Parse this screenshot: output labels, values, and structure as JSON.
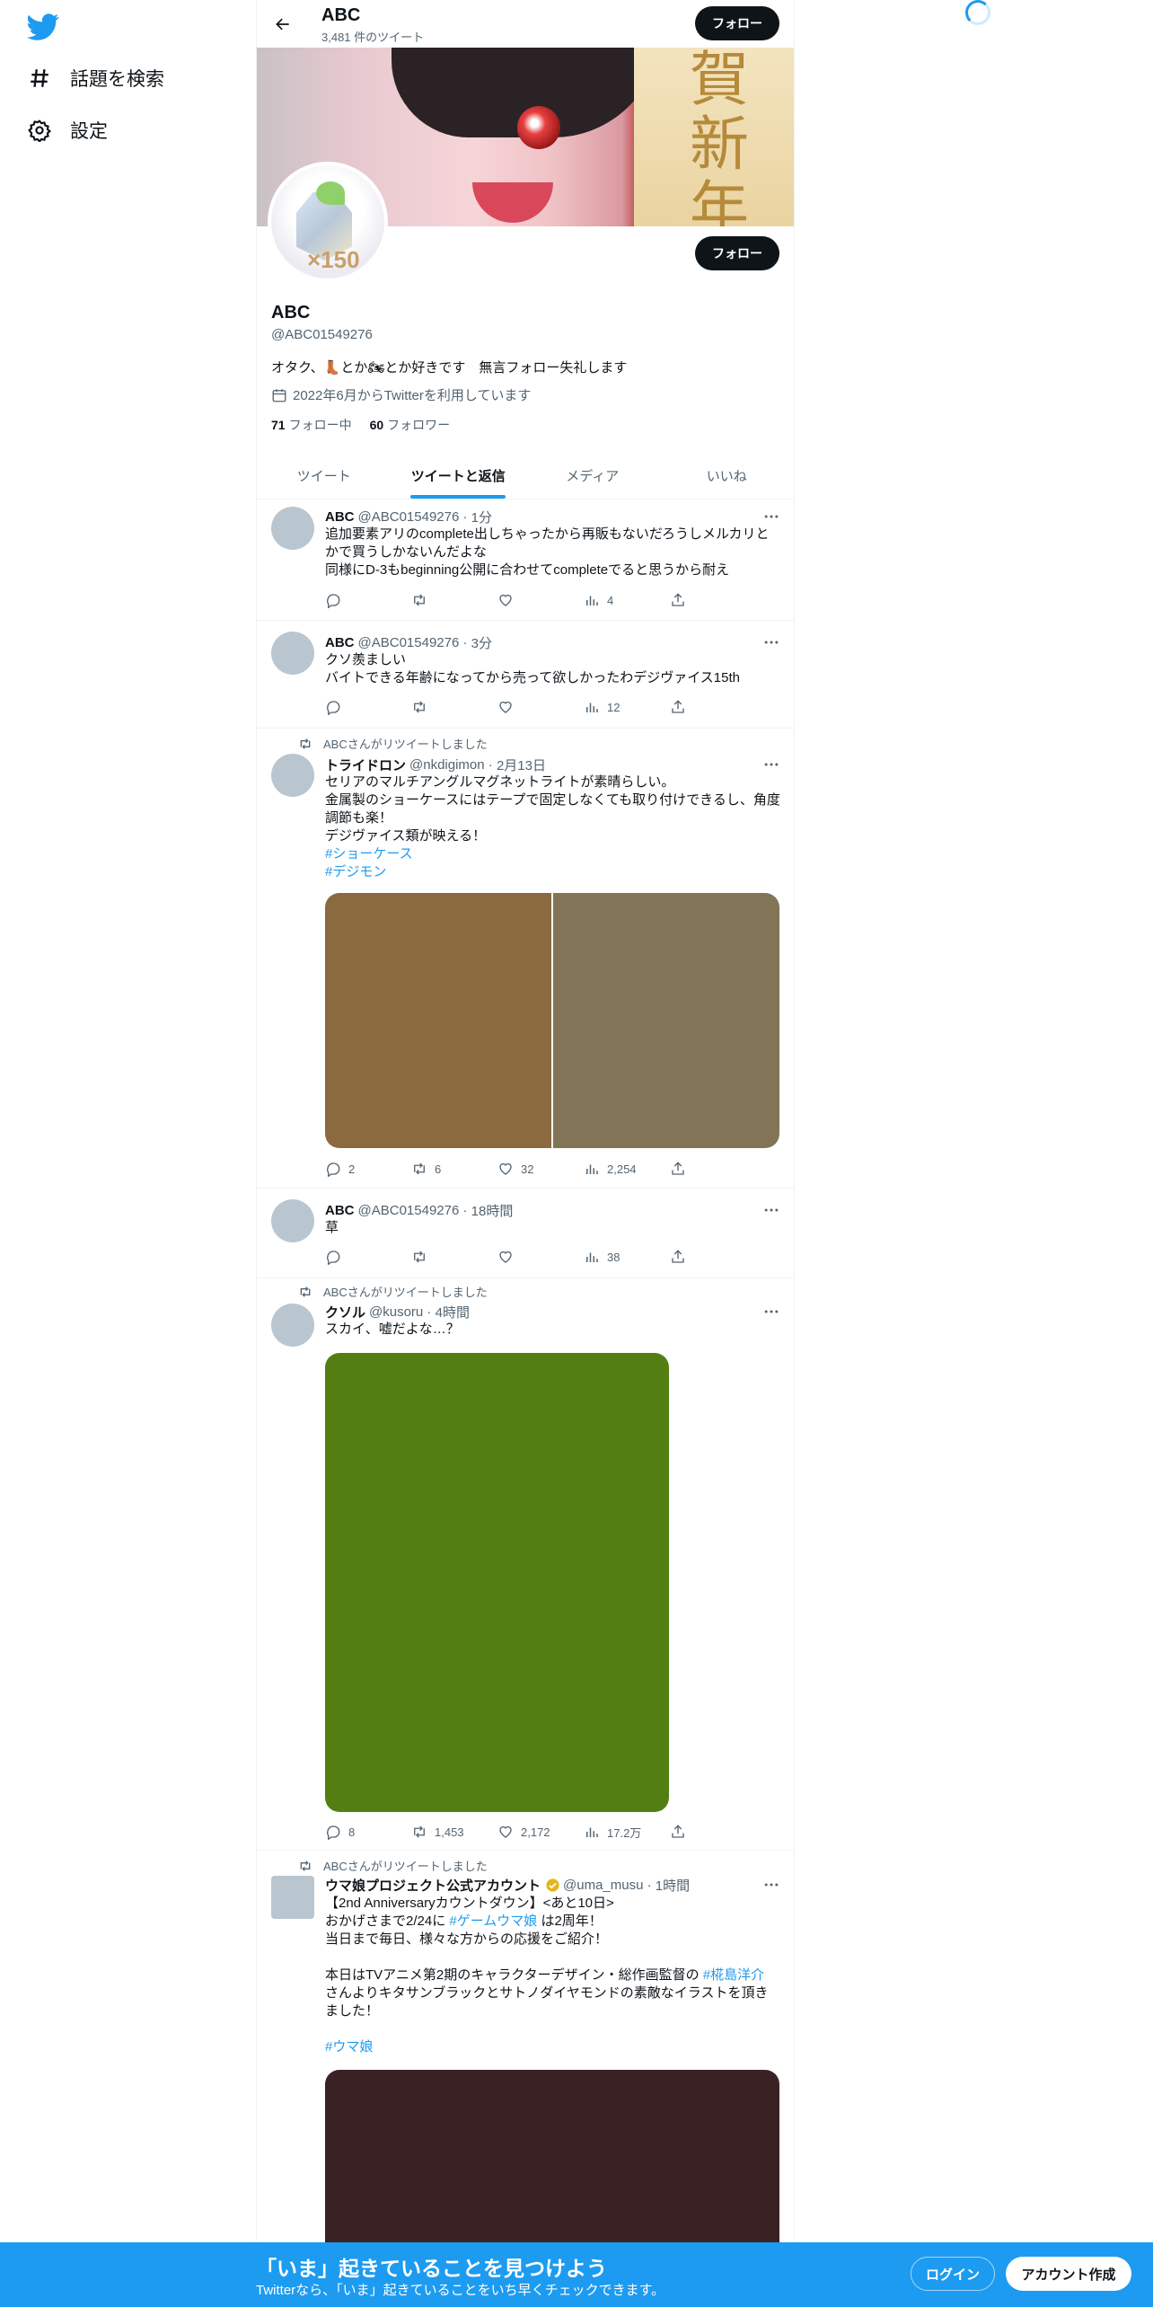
{
  "sidebar": {
    "logo_icon": "twitter-bird-icon",
    "explore_label": "話題を検索",
    "settings_label": "設定"
  },
  "header": {
    "name": "ABC",
    "tweet_count": "3,481 件のツイート",
    "follow_label": "フォロー"
  },
  "profile": {
    "name": "ABC",
    "handle": "@ABC01549276",
    "bio_pre": "オタク、",
    "bio_mid": "とか",
    "bio_post": "とか好きです　無言フォロー失礼します",
    "joined": "2022年6月からTwitterを利用しています",
    "following_count": "71",
    "following_label": "フォロー中",
    "followers_count": "60",
    "followers_label": "フォロワー",
    "follow_label": "フォロー",
    "banner_text": "賀新年",
    "avatar_text": "×150"
  },
  "tabs": [
    "ツイート",
    "ツイートと返信",
    "メディア",
    "いいね"
  ],
  "active_tab": 1,
  "tweets": [
    {
      "name": "ABC",
      "handle": "@ABC01549276",
      "time": "1分",
      "lines": [
        "追加要素アリのcomplete出しちゃったから再販もないだろうしメルカリとかで買うしかないんだよな",
        "同様にD-3もbeginning公開に合わせてcompleteでると思うから耐え"
      ],
      "replies": "",
      "retweets": "",
      "likes": "",
      "views": "4"
    },
    {
      "name": "ABC",
      "handle": "@ABC01549276",
      "time": "3分",
      "lines": [
        "クソ羨ましい",
        "バイトできる年齢になってから売って欲しかったわデジヴァイス15th"
      ],
      "replies": "",
      "retweets": "",
      "likes": "",
      "views": "12"
    },
    {
      "retweet_label": "ABCさんがリツイートしました",
      "name": "トライドロン",
      "handle": "@nkdigimon",
      "time": "2月13日",
      "lines": [
        "セリアのマルチアングルマグネットライトが素晴らしい。",
        "金属製のショーケースにはテープで固定しなくても取り付けできるし、角度調節も楽！",
        "デジヴァイス類が映える！"
      ],
      "hashtags": [
        "#ショーケース",
        "#デジモン"
      ],
      "replies": "2",
      "retweets": "6",
      "likes": "32",
      "views": "2,254",
      "media_colors": [
        "#8b6a3f",
        "#827457"
      ]
    },
    {
      "name": "ABC",
      "handle": "@ABC01549276",
      "time": "18時間",
      "lines": [
        "草"
      ],
      "replies": "",
      "retweets": "",
      "likes": "",
      "views": "38"
    },
    {
      "retweet_label": "ABCさんがリツイートしました",
      "name": "クソル",
      "handle": "@kusoru",
      "time": "4時間",
      "lines": [
        "スカイ、嘘だよな…？"
      ],
      "replies": "8",
      "retweets": "1,453",
      "likes": "2,172",
      "views": "17.2万",
      "media_colors": [
        "#537f12"
      ]
    },
    {
      "retweet_label": "ABCさんがリツイートしました",
      "name": "ウマ娘プロジェクト公式アカウント",
      "handle": "@uma_musu",
      "time": "1時間",
      "line1": "【2nd Anniversaryカウントダウン】<あと10日>",
      "line2_pre": "おかげさまで2/24に",
      "line2_tag": "#ゲームウマ娘",
      "line2_post": "は2周年！",
      "line3": "当日まで毎日、様々な方からの応援をご紹介！",
      "line4_pre": "本日はTVアニメ第2期のキャラクターデザイン・総作画監督の",
      "line4_tag": "#椛島洋介",
      "line5": "さんよりキタサンブラックとサトノダイヤモンドの素敵なイラストを頂きました！",
      "hashtag": "#ウマ娘",
      "media_colors": [
        "#3a2224"
      ]
    }
  ],
  "bottom_bar": {
    "title": "「いま」起きていることを見つけよう",
    "subtitle": "Twitterなら、「いま」起きていることをいち早くチェックできます。",
    "login_label": "ログイン",
    "signup_label": "アカウント作成"
  },
  "colors": {
    "accent": "#1d9bf0",
    "text": "#0f1419",
    "secondary": "#536471"
  }
}
